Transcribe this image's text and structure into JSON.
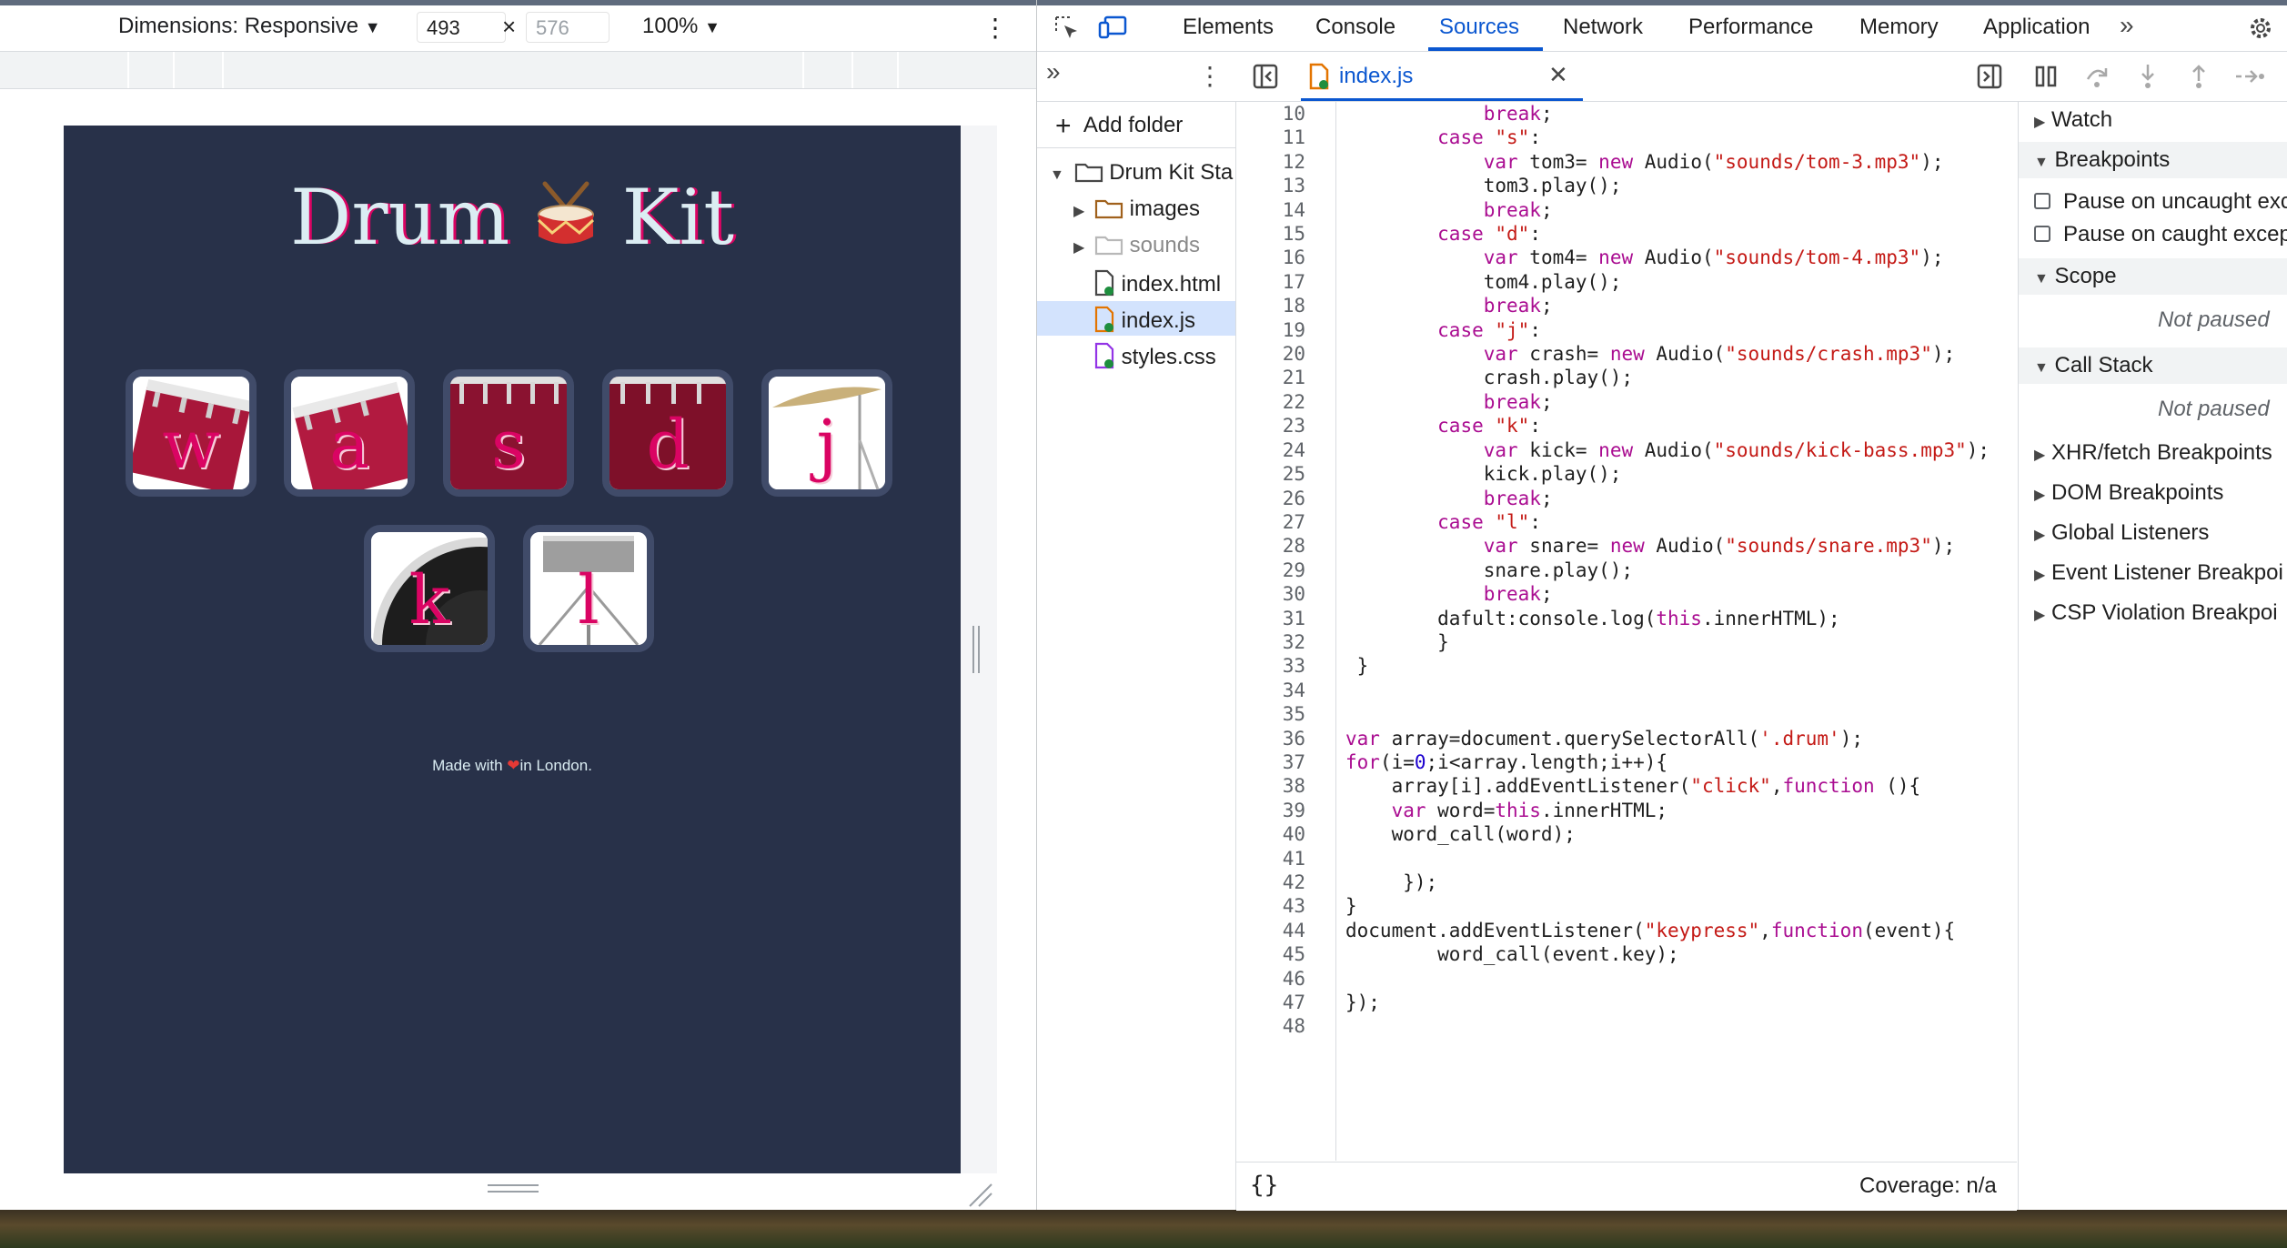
{
  "device_toolbar": {
    "dimensions_label": "Dimensions: Responsive",
    "width": "493",
    "height_placeholder": "576",
    "times": "×",
    "zoom": "100%"
  },
  "page": {
    "title_left": "Drum",
    "title_right": "Kit",
    "drums": [
      {
        "key": "w"
      },
      {
        "key": "a"
      },
      {
        "key": "s"
      },
      {
        "key": "d"
      },
      {
        "key": "j"
      },
      {
        "key": "k"
      },
      {
        "key": "l"
      }
    ],
    "footer_pre": "Made with ",
    "footer_post": "in London."
  },
  "devtools": {
    "tabs": [
      "Elements",
      "Console",
      "Sources",
      "Network",
      "Performance",
      "Memory",
      "Application"
    ],
    "file_tab": "index.js",
    "navigator": {
      "add_folder": "Add folder",
      "root": "Drum Kit Sta",
      "folders": [
        "images",
        "sounds"
      ],
      "files": [
        "index.html",
        "index.js",
        "styles.css"
      ]
    },
    "code_lines": [
      {
        "n": "10",
        "t": "            break;"
      },
      {
        "n": "11",
        "t": "        case \"s\":"
      },
      {
        "n": "12",
        "t": "            var tom3= new Audio(\"sounds/tom-3.mp3\");"
      },
      {
        "n": "13",
        "t": "            tom3.play();"
      },
      {
        "n": "14",
        "t": "            break;"
      },
      {
        "n": "15",
        "t": "        case \"d\":"
      },
      {
        "n": "16",
        "t": "            var tom4= new Audio(\"sounds/tom-4.mp3\");"
      },
      {
        "n": "17",
        "t": "            tom4.play();"
      },
      {
        "n": "18",
        "t": "            break;"
      },
      {
        "n": "19",
        "t": "        case \"j\":"
      },
      {
        "n": "20",
        "t": "            var crash= new Audio(\"sounds/crash.mp3\");"
      },
      {
        "n": "21",
        "t": "            crash.play();"
      },
      {
        "n": "22",
        "t": "            break;"
      },
      {
        "n": "23",
        "t": "        case \"k\":"
      },
      {
        "n": "24",
        "t": "            var kick= new Audio(\"sounds/kick-bass.mp3\");"
      },
      {
        "n": "25",
        "t": "            kick.play();"
      },
      {
        "n": "26",
        "t": "            break;"
      },
      {
        "n": "27",
        "t": "        case \"l\":"
      },
      {
        "n": "28",
        "t": "            var snare= new Audio(\"sounds/snare.mp3\");"
      },
      {
        "n": "29",
        "t": "            snare.play();"
      },
      {
        "n": "30",
        "t": "            break;"
      },
      {
        "n": "31",
        "t": "        dafult:console.log(this.innerHTML);"
      },
      {
        "n": "32",
        "t": "        }"
      },
      {
        "n": "33",
        "t": " }"
      },
      {
        "n": "34",
        "t": ""
      },
      {
        "n": "35",
        "t": ""
      },
      {
        "n": "36",
        "t": "var array=document.querySelectorAll('.drum');"
      },
      {
        "n": "37",
        "t": "for(i=0;i<array.length;i++){"
      },
      {
        "n": "38",
        "t": "    array[i].addEventListener(\"click\",function (){"
      },
      {
        "n": "39",
        "t": "    var word=this.innerHTML;"
      },
      {
        "n": "40",
        "t": "    word_call(word);"
      },
      {
        "n": "41",
        "t": ""
      },
      {
        "n": "42",
        "t": "     });"
      },
      {
        "n": "43",
        "t": "}"
      },
      {
        "n": "44",
        "t": "document.addEventListener(\"keypress\",function(event){"
      },
      {
        "n": "45",
        "t": "        word_call(event.key);"
      },
      {
        "n": "46",
        "t": ""
      },
      {
        "n": "47",
        "t": "});"
      },
      {
        "n": "48",
        "t": ""
      }
    ],
    "format_button": "{}",
    "coverage": "Coverage: n/a",
    "debugger": {
      "watch": "Watch",
      "breakpoints": "Breakpoints",
      "pause_uncaught": "Pause on uncaught exc",
      "pause_caught": "Pause on caught excep",
      "scope": "Scope",
      "scope_status": "Not paused",
      "call_stack": "Call Stack",
      "call_stack_status": "Not paused",
      "xhr": "XHR/fetch Breakpoints",
      "dom": "DOM Breakpoints",
      "global": "Global Listeners",
      "event": "Event Listener Breakpoi",
      "csp": "CSP Violation Breakpoi"
    }
  }
}
